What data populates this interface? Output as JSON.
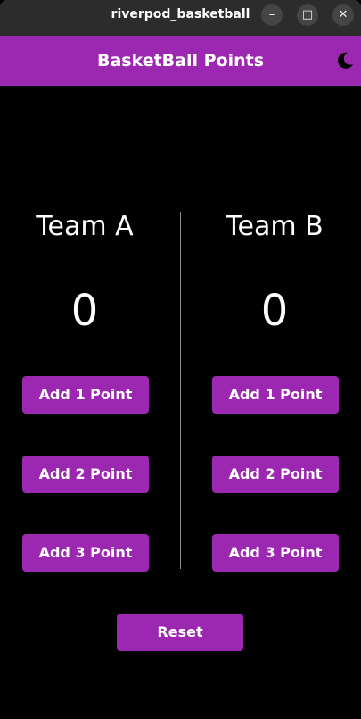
{
  "window": {
    "title": "riverpod_basketball",
    "buttons": {
      "minimize": "–",
      "maximize": "□",
      "close": "✕"
    }
  },
  "appbar": {
    "title": "BasketBall Points",
    "theme_icon": "moon-icon",
    "color": "#9c27b0"
  },
  "teams": [
    {
      "name": "Team A",
      "score": "0",
      "buttons": [
        "Add 1 Point",
        "Add 2 Point",
        "Add 3 Point"
      ]
    },
    {
      "name": "Team B",
      "score": "0",
      "buttons": [
        "Add 1 Point",
        "Add 2 Point",
        "Add 3 Point"
      ]
    }
  ],
  "reset_label": "Reset",
  "colors": {
    "accent": "#9c27b0",
    "background": "#000000",
    "text": "#ffffff"
  }
}
